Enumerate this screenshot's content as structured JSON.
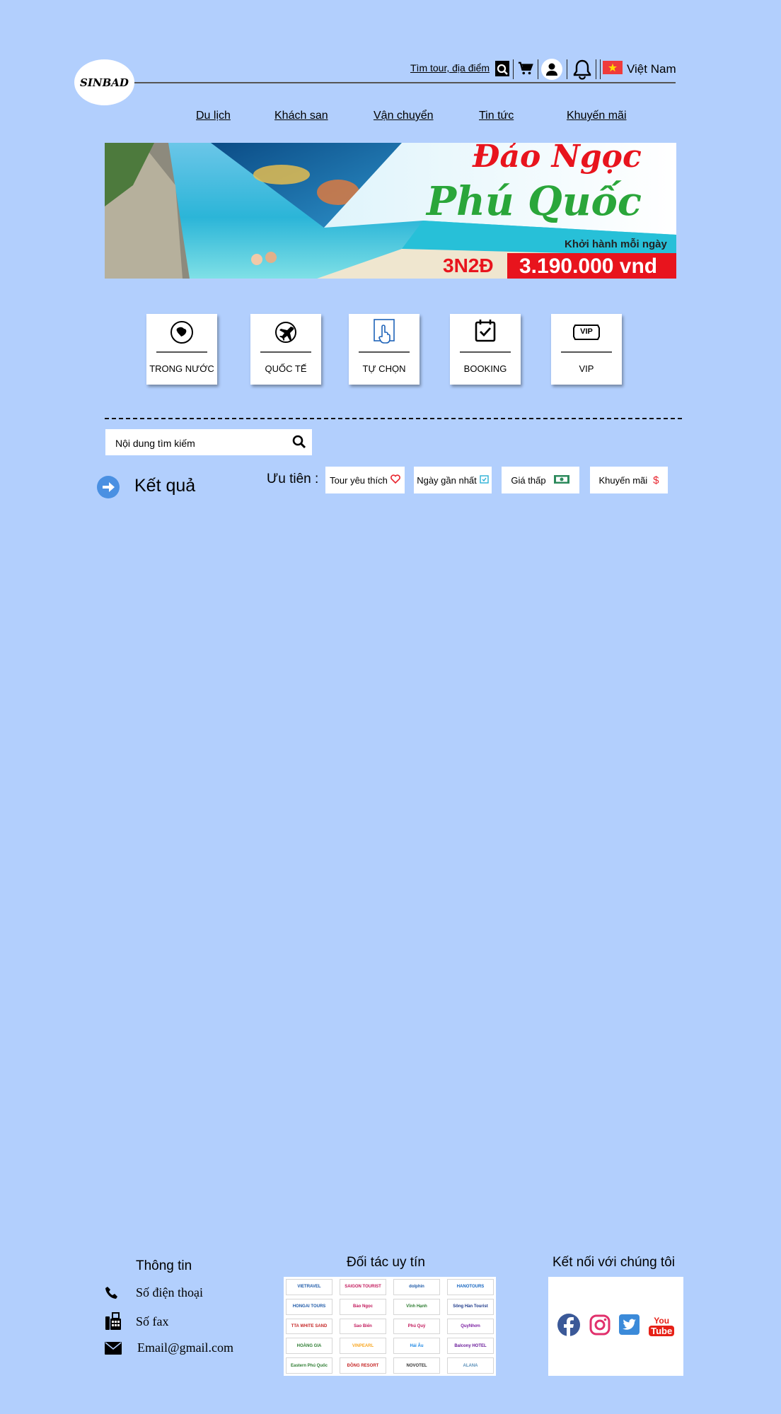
{
  "header": {
    "logo_text": "SINBAD",
    "search_link": "Tìm tour, địa điểm",
    "language": "Việt Nam"
  },
  "nav": [
    {
      "label": "Du lịch"
    },
    {
      "label": "Khách san"
    },
    {
      "label": "Vận chuyển"
    },
    {
      "label": "Tin tức"
    },
    {
      "label": "Khuyến mãi"
    }
  ],
  "banner": {
    "title_line1": "Đảo Ngọc",
    "title_line2": "Phú Quốc",
    "subtitle": "Khởi hành mỗi ngày",
    "duration": "3N2Đ",
    "price": "3.190.000 vnd"
  },
  "categories": [
    {
      "label": "TRONG NƯỚC",
      "icon": "vietnam-map-icon"
    },
    {
      "label": "QUỐC TẾ",
      "icon": "airplane-icon"
    },
    {
      "label": "TỰ CHỌN",
      "icon": "touch-hand-icon"
    },
    {
      "label": "BOOKING",
      "icon": "calendar-check-icon"
    },
    {
      "label": "VIP",
      "icon": "vip-ticket-icon",
      "badge": "VIP"
    }
  ],
  "search": {
    "placeholder": "Nội dung tìm kiếm"
  },
  "results": {
    "title": "Kết quả",
    "priority_label": "Ưu tiên :",
    "filters": [
      {
        "label": "Tour yêu thích",
        "icon": "heart-icon"
      },
      {
        "label": "Ngày gần nhất",
        "icon": "calendar-icon"
      },
      {
        "label": "Giá thấp",
        "icon": "money-icon"
      },
      {
        "label": "Khuyến mãi",
        "icon": "dollar-icon"
      }
    ]
  },
  "footer": {
    "info_title": "Thông tin",
    "phone": "Số điện thoại",
    "fax": "Số fax",
    "email": "Email@gmail.com",
    "partners_title": "Đối tác uy tín",
    "partners": [
      "VIETRAVEL",
      "SAIGON TOURIST",
      "dolphin",
      "HANOTOURS",
      "HONGAI TOURS",
      "Bảo Ngọc",
      "Vĩnh Hạnh",
      "Sông Hàn Tourist",
      "TTA WHITE SAND",
      "Sao Biển",
      "Phú Quý",
      "QuyNhơn",
      "HOÀNG GIA",
      "VINPEARL",
      "Hải Âu",
      "Balcony HOTEL",
      "Eastern Phú Quốc",
      "ĐỒNG RESORT",
      "NOVOTEL",
      "ALANA"
    ],
    "social_title": "Kết nối với chúng tôi",
    "social": [
      {
        "name": "Facebook",
        "icon": "facebook-icon",
        "color": "#3b5998"
      },
      {
        "name": "Instagram",
        "icon": "instagram-icon",
        "color": "#e1306c"
      },
      {
        "name": "Twitter",
        "icon": "twitter-icon",
        "color": "#3b8ad9"
      },
      {
        "name": "YouTube",
        "icon": "youtube-icon",
        "color": "#e62117",
        "text_top": "You",
        "text_bottom": "Tube"
      }
    ]
  }
}
